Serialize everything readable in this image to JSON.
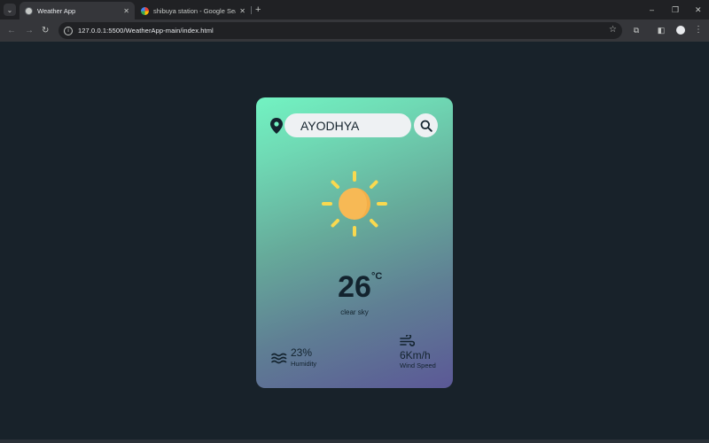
{
  "browser": {
    "tabs": [
      {
        "title": "Weather App",
        "active": true
      },
      {
        "title": "shibuya station - Google Search",
        "active": false
      }
    ],
    "new_tab_label": "+",
    "address": "127.0.0.1:5500/WeatherApp-main/index.html",
    "window_controls": {
      "minimize": "–",
      "restore": "❐",
      "close": "✕"
    }
  },
  "weather": {
    "search_value": "AYODHYA",
    "temperature": "26",
    "unit": "°C",
    "description": "clear sky",
    "humidity_value": "23%",
    "humidity_label": "Humidity",
    "wind_value": "6Km/h",
    "wind_label": "Wind Speed"
  },
  "colors": {
    "page_bg": "#18222a",
    "card_gradient_top": "#72f3c2",
    "card_gradient_bottom": "#5b5896",
    "text_dark": "#13232e",
    "sun": "#f7b955",
    "sun_rays": "#f9d94f"
  },
  "icons": {
    "location": "map-pin-icon",
    "search": "search-icon",
    "weather": "sun-icon",
    "humidity": "waves-icon",
    "wind": "wind-icon"
  }
}
